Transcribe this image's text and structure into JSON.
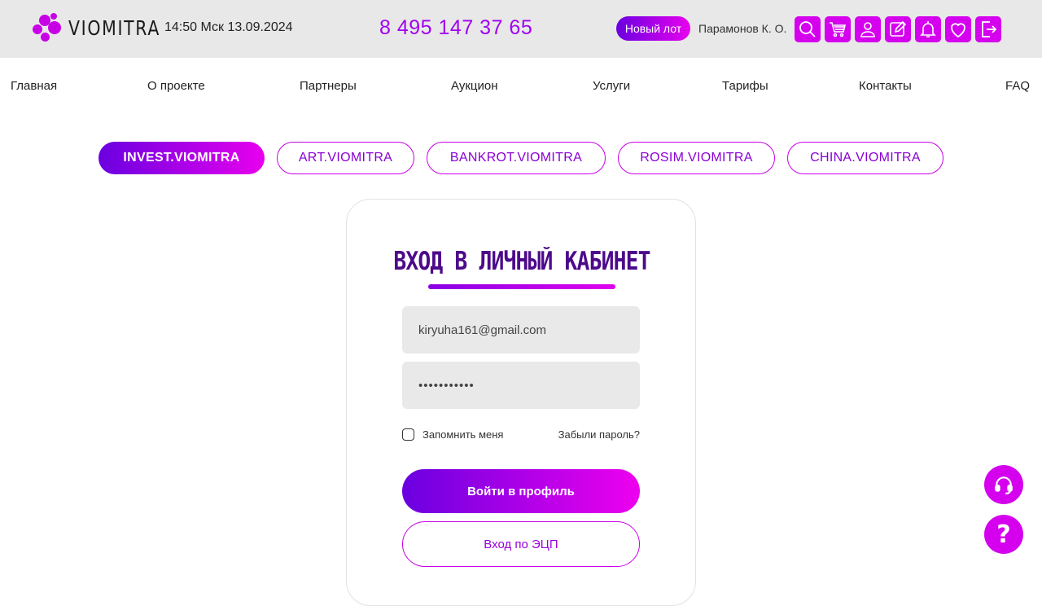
{
  "header": {
    "logo_text": "VIOMITRA",
    "clock": "14:50 Мск 13.09.2024",
    "phone": "8 495 147 37 65",
    "new_lot_label": "Новый лот",
    "username": "Парамонов К. О.",
    "icons": [
      "search-icon",
      "cart-icon",
      "user-icon",
      "edit-icon",
      "bell-icon",
      "heart-icon",
      "logout-icon"
    ]
  },
  "nav": {
    "items": [
      {
        "label": "Главная"
      },
      {
        "label": "О проекте"
      },
      {
        "label": "Партнеры"
      },
      {
        "label": "Аукцион"
      },
      {
        "label": "Услуги"
      },
      {
        "label": "Тарифы"
      },
      {
        "label": "Контакты"
      },
      {
        "label": "FAQ"
      }
    ]
  },
  "platforms": {
    "active": "INVEST.VIOMITRA",
    "tabs": [
      {
        "label": "INVEST.VIOMITRA"
      },
      {
        "label": "ART.VIOMITRA"
      },
      {
        "label": "BANKROT.VIOMITRA"
      },
      {
        "label": "ROSIM.VIOMITRA"
      },
      {
        "label": "CHINA.VIOMITRA"
      }
    ]
  },
  "login": {
    "title": "Вход в личный кабинет",
    "email_value": "kiryuha161@gmail.com",
    "password_value": "•••••••••••",
    "remember_label": "Запомнить меня",
    "forgot_label": "Забыли пароль?",
    "submit_label": "Войти в профиль",
    "ecp_label": "Вход по ЭЦП"
  },
  "floating": {
    "help_label": "?",
    "support_icon": "headset-icon"
  },
  "colors": {
    "accent": "#d400ee",
    "accent_dark": "#6a00e0",
    "title": "#4d0a8a",
    "phone": "#a100f0"
  }
}
